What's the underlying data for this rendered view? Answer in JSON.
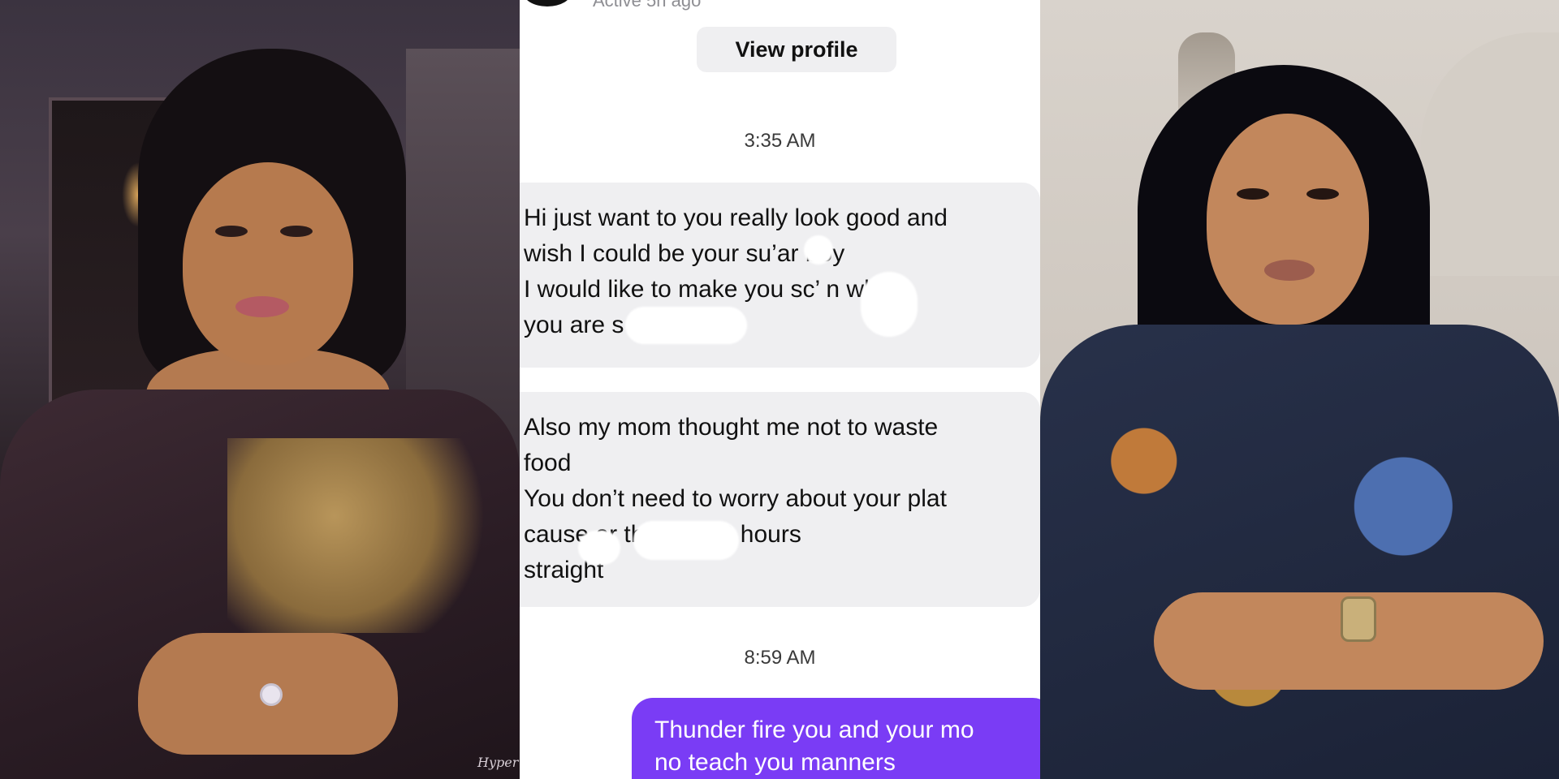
{
  "chat": {
    "status_text": "Active 5h ago",
    "view_profile_label": "View profile",
    "timestamps": [
      "3:35 AM",
      "8:59 AM"
    ],
    "incoming_messages": [
      {
        "lines": [
          "Hi just want to you really look good and",
          "wish I could be your su’ar boy",
          "I would like to make you sc’   n while",
          "you are s"
        ]
      },
      {
        "lines": [
          "Also my mom thought me not to waste",
          "food",
          "You don’t need to worry about your plat",
          "cause ar               them for 3 hours",
          "straight"
        ]
      }
    ],
    "outgoing_message": {
      "lines": [
        "Thunder fire you and your mo",
        "no teach you manners"
      ]
    },
    "colors": {
      "incoming_bubble": "#efeff1",
      "outgoing_bubble": "#7a3cf5",
      "timestamp": "#3a3a3a"
    }
  },
  "left_photo": {
    "watermark": "Hyper"
  },
  "right_photo": {}
}
